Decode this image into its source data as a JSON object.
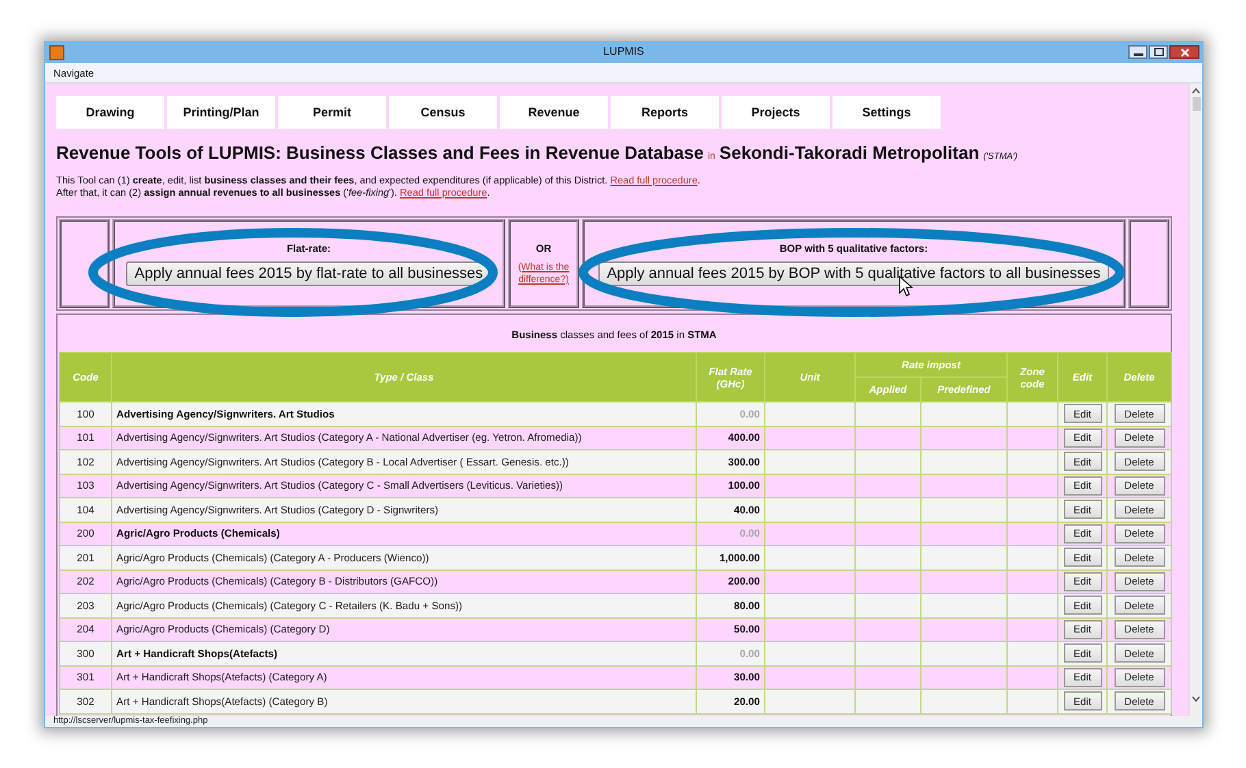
{
  "window": {
    "title": "LUPMIS"
  },
  "menu": [
    "Navigate"
  ],
  "tabs": [
    {
      "label": "Drawing",
      "selected": false
    },
    {
      "label": "Printing/Plan",
      "selected": false
    },
    {
      "label": "Permit",
      "selected": false
    },
    {
      "label": "Census",
      "selected": false
    },
    {
      "label": "Revenue",
      "selected": false
    },
    {
      "label": "Reports",
      "selected": false
    },
    {
      "label": "Projects",
      "selected": false
    },
    {
      "label": "Settings",
      "selected": false
    }
  ],
  "heading": {
    "title": "Revenue Tools of LUPMIS: Business Classes and Fees in Revenue Database",
    "connector": "in",
    "district": "Sekondi-Takoradi Metropolitan",
    "code": "('STMA')"
  },
  "intro": [
    {
      "text": "This Tool can (1) **create**, edit, list **business classes and their fees**, and expected expenditures (if applicable) of this District.",
      "link": "Read full procedure",
      "end": "."
    },
    {
      "text": "After that, it can (2) **assign annual revenues to all businesses** ('*fee-fixing*').",
      "link": "Read full procedure",
      "end": "."
    }
  ],
  "fee_options": {
    "flat_rate": {
      "label": "Flat-rate:",
      "button": "Apply annual fees 2015 by flat-rate to all businesses"
    },
    "separator": "OR",
    "help_link": "(What is the difference?)",
    "bop": {
      "label": "BOP with 5 qualitative factors:",
      "button": "Apply annual fees 2015 by BOP with 5 qualitative factors to all businesses"
    }
  },
  "table": {
    "caption": "**Business** classes and fees of **2015** in **STMA**",
    "columns": [
      {
        "label": "Code"
      },
      {
        "label": "Type / Class"
      },
      {
        "label": "Flat Rate (GHc)"
      },
      {
        "label": "Unit"
      },
      {
        "label": "Rate impost",
        "children": [
          {
            "label": "Applied"
          },
          {
            "label": "Predefined"
          }
        ]
      },
      {
        "label": "Zone code"
      },
      {
        "label": "Edit"
      },
      {
        "label": "Delete"
      }
    ],
    "rows": [
      {
        "kind": "group",
        "code": "100",
        "type": "Advertising Agency/Signwriters. Art Studios",
        "flat_rate": "0.00",
        "edit": "Edit",
        "delete": "Delete"
      },
      {
        "kind": "item",
        "code": "101",
        "type": "Advertising Agency/Signwriters. Art Studios (Category A - National Advertiser (eg. Yetron. Afromedia))",
        "flat_rate": "400.00",
        "edit": "Edit",
        "delete": "Delete"
      },
      {
        "kind": "item",
        "code": "102",
        "type": "Advertising Agency/Signwriters. Art Studios (Category B - Local Advertiser ( Essart. Genesis. etc.))",
        "flat_rate": "300.00",
        "edit": "Edit",
        "delete": "Delete"
      },
      {
        "kind": "item",
        "code": "103",
        "type": "Advertising Agency/Signwriters. Art Studios (Category C - Small Advertisers (Leviticus. Varieties))",
        "flat_rate": "100.00",
        "edit": "Edit",
        "delete": "Delete"
      },
      {
        "kind": "item",
        "code": "104",
        "type": "Advertising Agency/Signwriters. Art Studios (Category D - Signwriters)",
        "flat_rate": "40.00",
        "edit": "Edit",
        "delete": "Delete"
      },
      {
        "kind": "group",
        "code": "200",
        "type": "Agric/Agro Products (Chemicals)",
        "flat_rate": "0.00",
        "edit": "Edit",
        "delete": "Delete"
      },
      {
        "kind": "item",
        "code": "201",
        "type": "Agric/Agro Products (Chemicals) (Category A - Producers (Wienco))",
        "flat_rate": "1,000.00",
        "edit": "Edit",
        "delete": "Delete"
      },
      {
        "kind": "item",
        "code": "202",
        "type": "Agric/Agro Products (Chemicals) (Category B - Distributors (GAFCO))",
        "flat_rate": "200.00",
        "edit": "Edit",
        "delete": "Delete"
      },
      {
        "kind": "item",
        "code": "203",
        "type": "Agric/Agro Products (Chemicals) (Category C - Retailers (K. Badu + Sons))",
        "flat_rate": "80.00",
        "edit": "Edit",
        "delete": "Delete"
      },
      {
        "kind": "item",
        "code": "204",
        "type": "Agric/Agro Products (Chemicals) (Category D)",
        "flat_rate": "50.00",
        "edit": "Edit",
        "delete": "Delete"
      },
      {
        "kind": "group",
        "code": "300",
        "type": "Art + Handicraft Shops(Atefacts)",
        "flat_rate": "0.00",
        "edit": "Edit",
        "delete": "Delete"
      },
      {
        "kind": "item",
        "code": "301",
        "type": "Art + Handicraft Shops(Atefacts) (Category A)",
        "flat_rate": "30.00",
        "edit": "Edit",
        "delete": "Delete"
      },
      {
        "kind": "item",
        "code": "302",
        "type": "Art + Handicraft Shops(Atefacts) (Category B)",
        "flat_rate": "20.00",
        "edit": "Edit",
        "delete": "Delete"
      }
    ]
  },
  "status_bar": "http://lscserver/lupmis-tax-feefixing.php"
}
